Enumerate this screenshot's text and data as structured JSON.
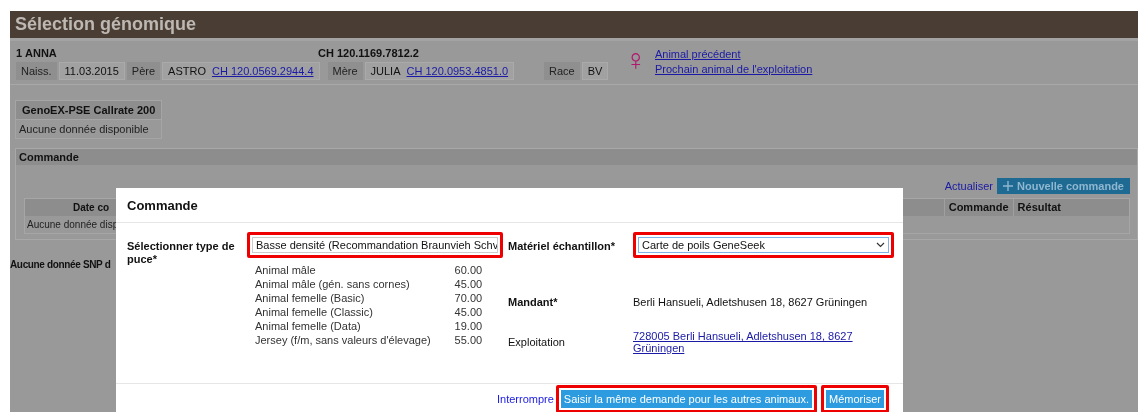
{
  "header": {
    "title": "Sélection génomique"
  },
  "animal": {
    "number": "1",
    "name": "ANNA",
    "id": "CH 120.1169.7812.2",
    "sex_symbol": "♀",
    "fields": [
      {
        "label": "Naiss.",
        "value": "11.03.2015"
      },
      {
        "label": "Père",
        "value": "ASTRO",
        "link": "CH 120.0569.2944.4"
      },
      {
        "label": "Mère",
        "value": "JULIA",
        "link": "CH 120.0953.4851.0"
      },
      {
        "label": "Race",
        "value": "BV"
      }
    ],
    "links": [
      "Animal précédent",
      "Prochain animal de l'exploitation"
    ]
  },
  "genoex_table": {
    "header": "GenoEX-PSE Callrate 200",
    "empty": "Aucune donnée disponible"
  },
  "order_section": {
    "title": "Commande",
    "refresh": "Actualiser",
    "new_button": "Nouvelle commande",
    "columns": [
      "Date co",
      "Commande",
      "Résultat"
    ],
    "empty": "Aucune donnée disp"
  },
  "snp_note": "Aucune donnée SNP d",
  "dialog": {
    "title": "Commande",
    "chip_label": "Sélectionner type de puce*",
    "chip_select": {
      "value": "Basse densité (Recommandation Braunvieh Schv",
      "highlighted": true
    },
    "prices": [
      {
        "label": "Animal mâle",
        "price": "60.00"
      },
      {
        "label": "Animal mâle (gén. sans cornes)",
        "price": "45.00"
      },
      {
        "label": "Animal femelle (Basic)",
        "price": "70.00"
      },
      {
        "label": "Animal femelle (Classic)",
        "price": "45.00"
      },
      {
        "label": "Animal femelle (Data)",
        "price": "19.00"
      },
      {
        "label": "Jersey (f/m, sans valeurs d'élevage)",
        "price": "55.00"
      }
    ],
    "material_label": "Matériel échantillon*",
    "material_select": {
      "value": "Carte de poils GeneSeek",
      "highlighted": true
    },
    "client_label": "Mandant*",
    "client": "Berli Hansueli, Adletshusen 18, 8627 Grüningen",
    "farm_label": "Exploitation",
    "farm_link": "728005 Berli Hansueli, Adletshusen 18, 8627 Grüningen",
    "cancel": "Interrompre",
    "buttons": [
      {
        "label": "Saisir la même demande pour les autres animaux.",
        "highlighted": true
      },
      {
        "label": "Mémoriser",
        "highlighted": true
      }
    ]
  }
}
